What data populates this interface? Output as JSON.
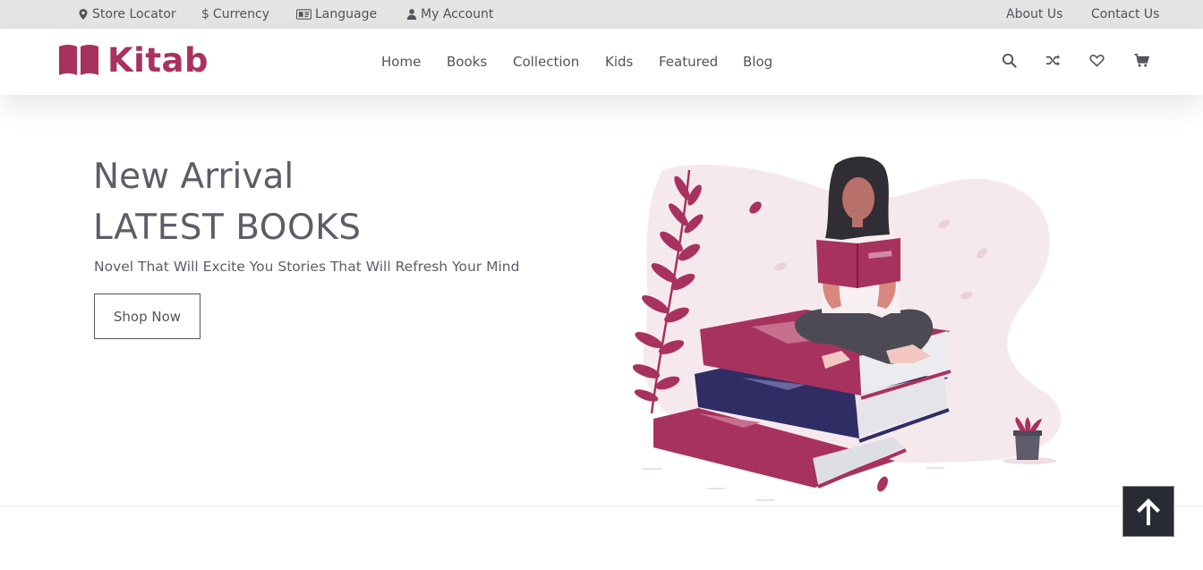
{
  "topbar": {
    "store_locator": "Store Locator",
    "currency": "Currency",
    "language": "Language",
    "my_account": "My Account",
    "about_us": "About Us",
    "contact_us": "Contact Us"
  },
  "brand": {
    "name": "Kitab",
    "color": "#a8325e"
  },
  "nav": {
    "home": "Home",
    "books": "Books",
    "collection": "Collection",
    "kids": "Kids",
    "featured": "Featured",
    "blog": "Blog"
  },
  "header_icons": [
    "search-icon",
    "shuffle-icon",
    "heart-icon",
    "cart-icon"
  ],
  "hero": {
    "title_line1": "New Arrival",
    "title_line2": "LATEST BOOKS",
    "subtitle": "Novel That Will Excite You Stories That Will Refresh Your Mind",
    "cta": "Shop Now"
  },
  "colors": {
    "text": "#5f5c68",
    "topbar_bg": "#e4e4e4",
    "book_red": "#a8325e",
    "book_navy": "#2f2d64",
    "back_to_top_bg": "#282b33"
  }
}
